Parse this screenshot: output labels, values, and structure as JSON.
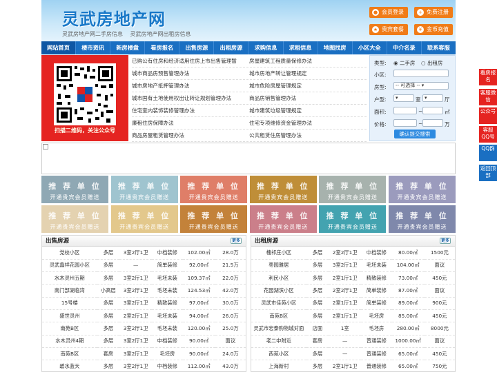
{
  "header": {
    "logo": "灵武房地产网",
    "sub": [
      "灵武房地产网二手房信息",
      "灵武房地产网出租房信息"
    ],
    "buttons": [
      {
        "label": "会员登录",
        "icon": "user"
      },
      {
        "label": "免费注册",
        "icon": "register"
      },
      {
        "label": "贵宾套餐",
        "icon": "vip"
      },
      {
        "label": "金币充值",
        "icon": "coin"
      }
    ]
  },
  "nav": [
    "网站首页",
    "楼市资讯",
    "新房楼盘",
    "看房报名",
    "出售房源",
    "出租房源",
    "求购信息",
    "求租信息",
    "地图找房",
    "小区大全",
    "中介名录",
    "联系客服"
  ],
  "qr_caption": "扫描二维码，关注公众号",
  "links": [
    [
      "已购公有住房和经济适用住房上市出售管理暂",
      "房屋建筑工程质量保修办法"
    ],
    [
      "城市商品房预售管理办法",
      "城市房地产转让管理规定"
    ],
    [
      "城市房地产抵押管理办法",
      "城市危险房屋管理规定"
    ],
    [
      "城市国有土地使用权出让转让规划管理办法",
      "商品房销售管理办法"
    ],
    [
      "住宅室内装饰装修管理办法",
      "城市建筑垃圾管理规定"
    ],
    [
      "廉租住房保障办法",
      "住宅专项维修资金管理办法"
    ],
    [
      "商品房屋租赁管理办法",
      "公共租赁住房管理办法"
    ]
  ],
  "search": {
    "type_label": "类型:",
    "opt1": "二手房",
    "opt2": "出租房",
    "community_label": "小区:",
    "room_label": "房型:",
    "select_default": "-- 可选择 --",
    "layout_label": "户型:",
    "shi": "室",
    "ting": "厅",
    "area_label": "面积:",
    "area_unit": "㎡",
    "price_label": "价格:",
    "price_unit": "万",
    "submit": "确认提交搜索"
  },
  "ads": [
    {
      "t1": "推 荐 单 位",
      "t2": "开通贵宾会员赠送",
      "color": "#8fa8b4"
    },
    {
      "t1": "推 荐 单 位",
      "t2": "开通贵宾会员赠送",
      "color": "#9fc4cf"
    },
    {
      "t1": "推 荐 单 位",
      "t2": "开通贵宾会员赠送",
      "color": "#df7e68"
    },
    {
      "t1": "推 荐 单 位",
      "t2": "开通贵宾会员赠送",
      "color": "#bf8e38"
    },
    {
      "t1": "推 荐 单 位",
      "t2": "开通贵宾会员赠送",
      "color": "#a7b2ad"
    },
    {
      "t1": "推 荐 单 位",
      "t2": "开通贵宾会员赠送",
      "color": "#9b9bbd"
    },
    {
      "t1": "推 荐 单 位",
      "t2": "开通贵宾会员赠送",
      "color": "#e4d2b0"
    },
    {
      "t1": "推 荐 单 位",
      "t2": "开通贵宾会员赠送",
      "color": "#e3c88c"
    },
    {
      "t1": "推 荐 单 位",
      "t2": "开通贵宾会员赠送",
      "color": "#c3823a"
    },
    {
      "t1": "推 荐 单 位",
      "t2": "开通贵宾会员赠送",
      "color": "#cb7f8a"
    },
    {
      "t1": "推 荐 单 位",
      "t2": "开通贵宾会员赠送",
      "color": "#43a3b0"
    },
    {
      "t1": "推 荐 单 位",
      "t2": "开通贵宾会员赠送",
      "color": "#7f88ab"
    }
  ],
  "sale": {
    "title": "出售房源",
    "more": "更多",
    "rows": [
      [
        "党校小区",
        "多层",
        "3室2厅1卫",
        "中档装修",
        "102.00㎡",
        "28.0万"
      ],
      [
        "灵武鑫祥花园小区",
        "多层",
        "—",
        "简单装修",
        "92.00㎡",
        "21.5万"
      ],
      [
        "水木灵州五期",
        "多层",
        "3室2厅1卫",
        "毛坯未装",
        "109.37㎡",
        "22.0万"
      ],
      [
        "南门部湖临湾",
        "小高层",
        "3室2厅1卫",
        "毛坯未装",
        "124.53㎡",
        "42.0万"
      ],
      [
        "15号楼",
        "多层",
        "3室2厅1卫",
        "精致装修",
        "97.00㎡",
        "30.0万"
      ],
      [
        "盛世灵州",
        "多层",
        "2室2厅1卫",
        "毛坯未装",
        "94.00㎡",
        "26.0万"
      ],
      [
        "南苑B区",
        "多层",
        "3室2厅1卫",
        "毛坯未装",
        "120.00㎡",
        "25.0万"
      ],
      [
        "水木灵州4期",
        "多层",
        "3室2厅1卫",
        "中档装修",
        "90.00㎡",
        "面议"
      ],
      [
        "南苑B区",
        "套房",
        "3室2厅1卫",
        "毛坯房",
        "90.00㎡",
        "24.0万"
      ],
      [
        "碧水蓝天",
        "多层",
        "3室2厅1卫",
        "中档装修",
        "112.00㎡",
        "43.0万"
      ]
    ]
  },
  "rent": {
    "title": "出租房源",
    "more": "更多",
    "rows": [
      [
        "槐祁庄小区",
        "多层",
        "2室2厅1卫",
        "中档装修",
        "80.00㎡",
        "1500元"
      ],
      [
        "枣园雅居",
        "多层",
        "3室2厅1卫",
        "毛坯未装",
        "104.00㎡",
        "面议"
      ],
      [
        "利民小区",
        "多层",
        "2室1厅1卫",
        "精致装修",
        "73.00㎡",
        "450元"
      ],
      [
        "花园湖滨小区",
        "多层",
        "2室2厅1卫",
        "简单装修",
        "87.00㎡",
        "面议"
      ],
      [
        "灵武市佳苑小区",
        "多层",
        "2室1厅1卫",
        "简单装修",
        "89.00㎡",
        "900元"
      ],
      [
        "南苑B区",
        "多层",
        "2室1厅1卫",
        "毛坯房",
        "85.00㎡",
        "450元"
      ],
      [
        "灵武市宏泰购物城对面",
        "店面",
        "1室",
        "毛坯房",
        "280.00㎡",
        "8000元"
      ],
      [
        "老二中附近",
        "套房",
        "—",
        "普通装修",
        "1000.00㎡",
        "面议"
      ],
      [
        "西苑小区",
        "多层",
        "—",
        "普通装修",
        "65.00㎡",
        "450元"
      ],
      [
        "上海新村",
        "多层",
        "2室1厅1卫",
        "普通装修",
        "65.00㎡",
        "750元"
      ]
    ]
  },
  "side": [
    {
      "label": "看房报名",
      "color": "#e52421"
    },
    {
      "label": "客服微信",
      "color": "#e52421"
    },
    {
      "label": "公众号",
      "color": "#e52421"
    },
    {
      "label": "客服QQ号",
      "color": "#e52421"
    },
    {
      "label": "QQ群",
      "color": "#1a6fc2"
    },
    {
      "label": "返回顶部",
      "color": "#1a6fc2"
    }
  ]
}
